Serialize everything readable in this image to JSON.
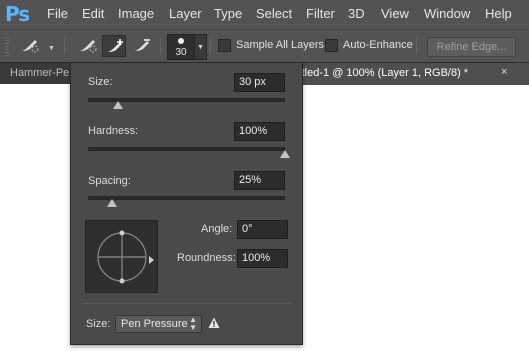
{
  "app": {
    "logo": "Ps",
    "logo_color": "#5bb5ff"
  },
  "menu": [
    {
      "label": "File"
    },
    {
      "label": "Edit"
    },
    {
      "label": "Image"
    },
    {
      "label": "Layer"
    },
    {
      "label": "Type"
    },
    {
      "label": "Select"
    },
    {
      "label": "Filter"
    },
    {
      "label": "3D"
    },
    {
      "label": "View"
    },
    {
      "label": "Window"
    },
    {
      "label": "Help"
    }
  ],
  "options_bar": {
    "tool_icons": [
      "quick-selection-brush-icon",
      "new-selection-brush-icon",
      "add-to-selection-brush-icon",
      "subtract-from-selection-brush-icon"
    ],
    "brush_size": "30",
    "sample_all_layers": {
      "label": "Sample All Layers",
      "checked": false
    },
    "auto_enhance": {
      "label": "Auto-Enhance",
      "checked": false
    },
    "refine_edge": "Refine Edge..."
  },
  "tabs": {
    "left_tab": "Hammer-Pe",
    "active_tab": "ntitled-1 @ 100% (Layer 1, RGB/8) *",
    "close_glyph": "×"
  },
  "brush_popup": {
    "size": {
      "label": "Size:",
      "value": "30 px",
      "slider_fraction": 0.15
    },
    "hardness": {
      "label": "Hardness:",
      "value": "100%",
      "slider_fraction": 1.0
    },
    "spacing": {
      "label": "Spacing:",
      "value": "25%",
      "slider_fraction": 0.12
    },
    "angle": {
      "label": "Angle:",
      "value": "0°"
    },
    "roundness": {
      "label": "Roundness:",
      "value": "100%"
    },
    "size_control": {
      "label": "Size:",
      "value": "Pen Pressure",
      "warning_icon": "warning-icon"
    }
  }
}
